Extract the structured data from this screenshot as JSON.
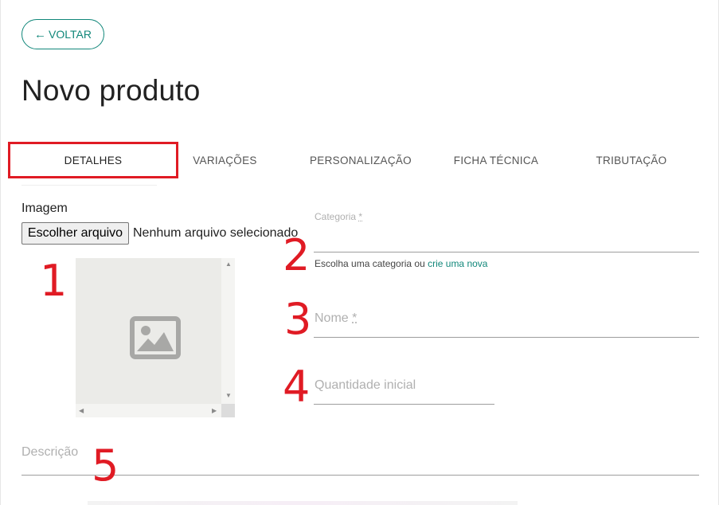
{
  "header": {
    "back_label": "VOLTAR",
    "back_icon": "arrow-left-icon",
    "title": "Novo produto"
  },
  "tabs": [
    {
      "label": "DETALHES",
      "active": true
    },
    {
      "label": "VARIAÇÕES",
      "active": false
    },
    {
      "label": "PERSONALIZAÇÃO",
      "active": false
    },
    {
      "label": "FICHA TÉCNICA",
      "active": false
    },
    {
      "label": "TRIBUTAÇÃO",
      "active": false
    }
  ],
  "image": {
    "label": "Imagem",
    "file_button": "Escolher arquivo",
    "file_status": "Nenhum arquivo selecionado",
    "placeholder_icon": "image-placeholder-icon"
  },
  "form": {
    "categoria_label": "Categoria",
    "categoria_required": "*",
    "categoria_helper_prefix": "Escolha uma categoria ou",
    "categoria_helper_link": "crie uma nova",
    "nome_label": "Nome",
    "nome_required": "*",
    "quantidade_label": "Quantidade inicial",
    "descricao_label": "Descrição"
  },
  "annotations": [
    "1",
    "2",
    "3",
    "4",
    "5"
  ],
  "colors": {
    "accent": "#11877a",
    "annotation_red": "#e01b24",
    "label_gray": "#b0b0b0"
  }
}
